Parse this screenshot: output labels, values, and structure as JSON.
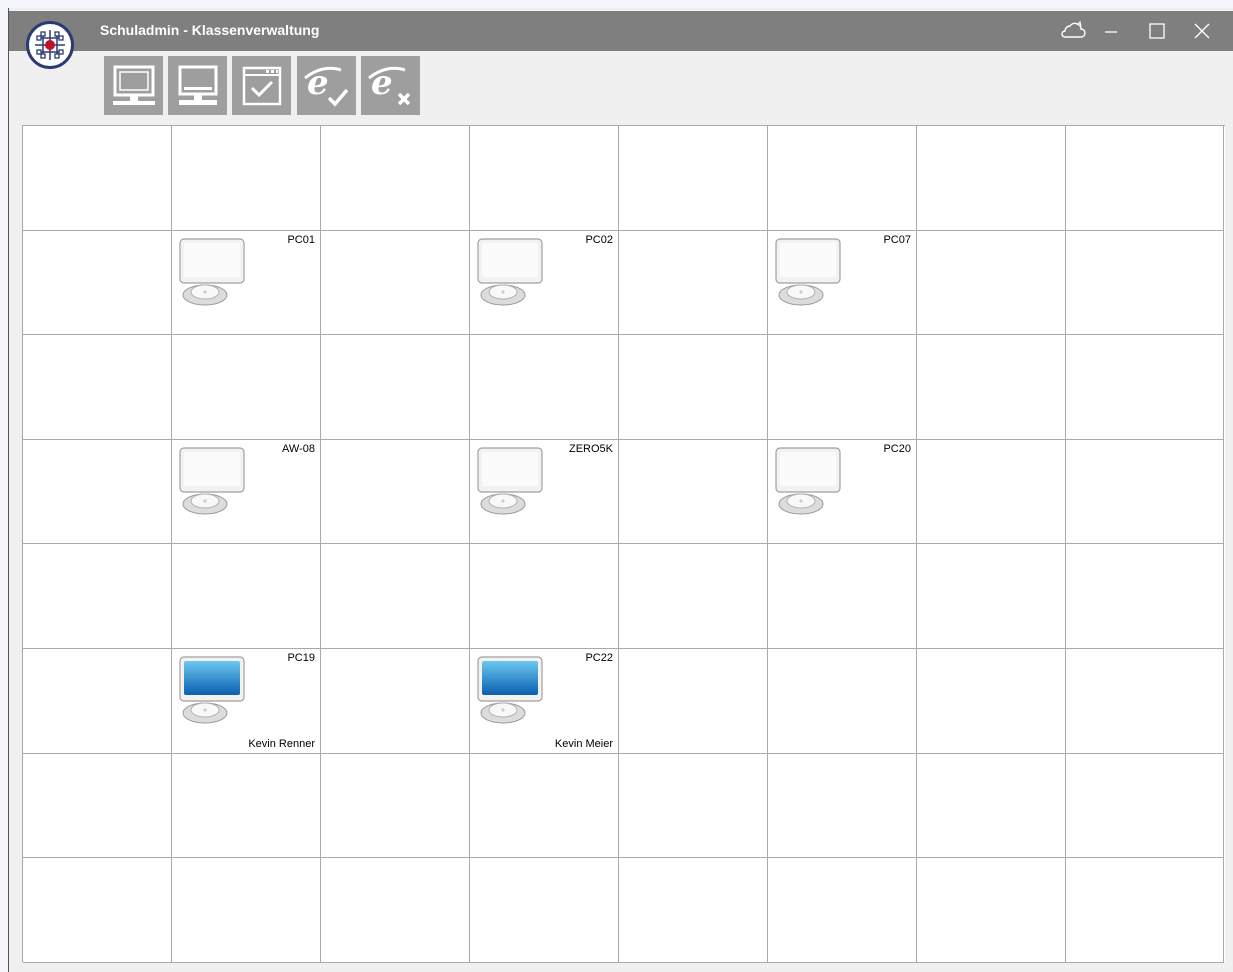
{
  "window": {
    "title": "Schuladmin - Klassenverwaltung"
  },
  "window_controls": {
    "cloud_icon": "cloud-icon",
    "minimize_icon": "minimize-icon",
    "maximize_icon": "maximize-icon",
    "close_icon": "close-icon"
  },
  "toolbar": {
    "buttons": [
      {
        "name": "monitor-toolbar-button",
        "icon": "monitor-icon"
      },
      {
        "name": "computer-toolbar-button",
        "icon": "computer-icon"
      },
      {
        "name": "window-check-toolbar-button",
        "icon": "window-check-icon"
      },
      {
        "name": "internet-allow-toolbar-button",
        "icon": "internet-check-icon"
      },
      {
        "name": "internet-block-toolbar-button",
        "icon": "internet-block-icon"
      }
    ]
  },
  "grid": {
    "rows": 8,
    "cols": 8,
    "computers": [
      {
        "name": "PC01",
        "row": 1,
        "col": 1,
        "state": "off",
        "user": ""
      },
      {
        "name": "PC02",
        "row": 1,
        "col": 3,
        "state": "off",
        "user": ""
      },
      {
        "name": "PC07",
        "row": 1,
        "col": 5,
        "state": "off",
        "user": ""
      },
      {
        "name": "AW-08",
        "row": 3,
        "col": 1,
        "state": "off",
        "user": ""
      },
      {
        "name": "ZERO5K",
        "row": 3,
        "col": 3,
        "state": "off",
        "user": ""
      },
      {
        "name": "PC20",
        "row": 3,
        "col": 5,
        "state": "off",
        "user": ""
      },
      {
        "name": "PC19",
        "row": 5,
        "col": 1,
        "state": "on",
        "user": "Kevin Renner"
      },
      {
        "name": "PC22",
        "row": 5,
        "col": 3,
        "state": "on",
        "user": "Kevin Meier"
      }
    ]
  },
  "colors": {
    "titlebar": "#7f7f7f",
    "toolbar_button": "#9e9e9e",
    "logo_ring": "#2b3a75",
    "logo_center": "#c0102a",
    "screen_on_top": "#6cc8f0",
    "screen_on_bottom": "#0a5fb0"
  }
}
